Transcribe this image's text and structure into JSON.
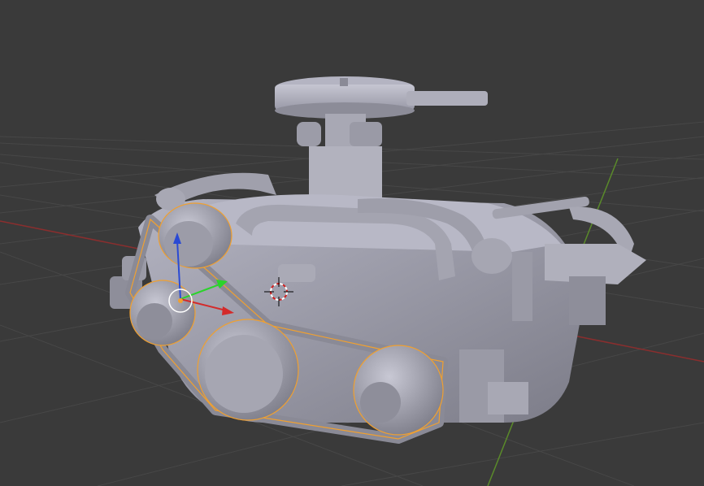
{
  "viewport": {
    "mode": "3d-viewport",
    "background_color": "#3a3a3a",
    "grid_color": "#4a4a4a",
    "axis_x_color": "#9b2d2d",
    "axis_y_color": "#5a8a2a",
    "selection_outline_color": "#f0a030",
    "model_base_color": "#9a9aa6"
  },
  "scene": {
    "objects": [
      {
        "name": "engine-body",
        "selected": false
      },
      {
        "name": "belt-pulley-assembly",
        "selected": true
      }
    ]
  },
  "transform_gizmo": {
    "axes": [
      "x",
      "y",
      "z"
    ],
    "x_color": "#d42a2a",
    "y_color": "#2ad42a",
    "z_color": "#2a4ad4"
  },
  "cursor_3d": {
    "icon": "3d-cursor-icon"
  }
}
